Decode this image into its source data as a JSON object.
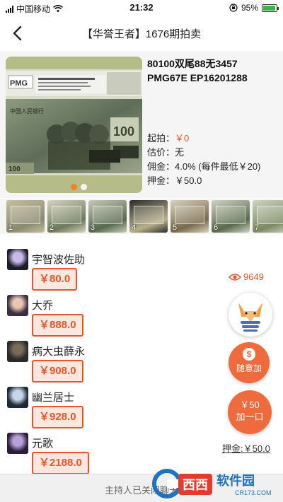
{
  "status": {
    "carrier": "中国移动",
    "time": "21:32",
    "battery_pct": "95%",
    "battery_fraction": 0.95
  },
  "nav": {
    "back_icon": "chevron-left-icon",
    "title": "【华誉王者】1676期拍卖"
  },
  "lot": {
    "name": "80100双尾88无3457 PMG67E EP16201288",
    "image_count": 2,
    "active_image": 0,
    "fields": [
      {
        "label": "起拍：",
        "value": "￥0",
        "highlight": true
      },
      {
        "label": "估价：",
        "value": "无",
        "highlight": false
      },
      {
        "label": "佣金：",
        "value": "4.0% (每件最低￥20)",
        "highlight": false
      },
      {
        "label": "押金：",
        "value": "￥50.0",
        "highlight": false
      }
    ],
    "thumbnails": [
      {
        "num": "1"
      },
      {
        "num": "2"
      },
      {
        "num": "3"
      },
      {
        "num": "4"
      },
      {
        "num": "5"
      },
      {
        "num": "6"
      },
      {
        "num": "7"
      }
    ]
  },
  "bids": [
    {
      "name": "宇智波佐助",
      "price": "￥80.0"
    },
    {
      "name": "大乔",
      "price": "￥888.0"
    },
    {
      "name": "病大虫薛永",
      "price": "￥908.0"
    },
    {
      "name": "幽兰居士",
      "price": "￥928.0"
    },
    {
      "name": "元歌",
      "price": "￥2188.0"
    }
  ],
  "side": {
    "views": "9649",
    "any_amount_label": "随意加",
    "any_amount_icon": "dollar-coin-icon",
    "plus_one_amount": "￥50",
    "plus_one_label": "加一口",
    "deposit_label": "押金:￥50.0"
  },
  "footer": {
    "message": "主持人已关闭聊天"
  },
  "watermark": {
    "text": "西西软件园",
    "url": "CR173.COM"
  },
  "colors": {
    "accent": "#e8552a",
    "fab": "#ef6a3c",
    "price_bg": "#fbe7de",
    "lot_bg": "#f5f5f5"
  }
}
